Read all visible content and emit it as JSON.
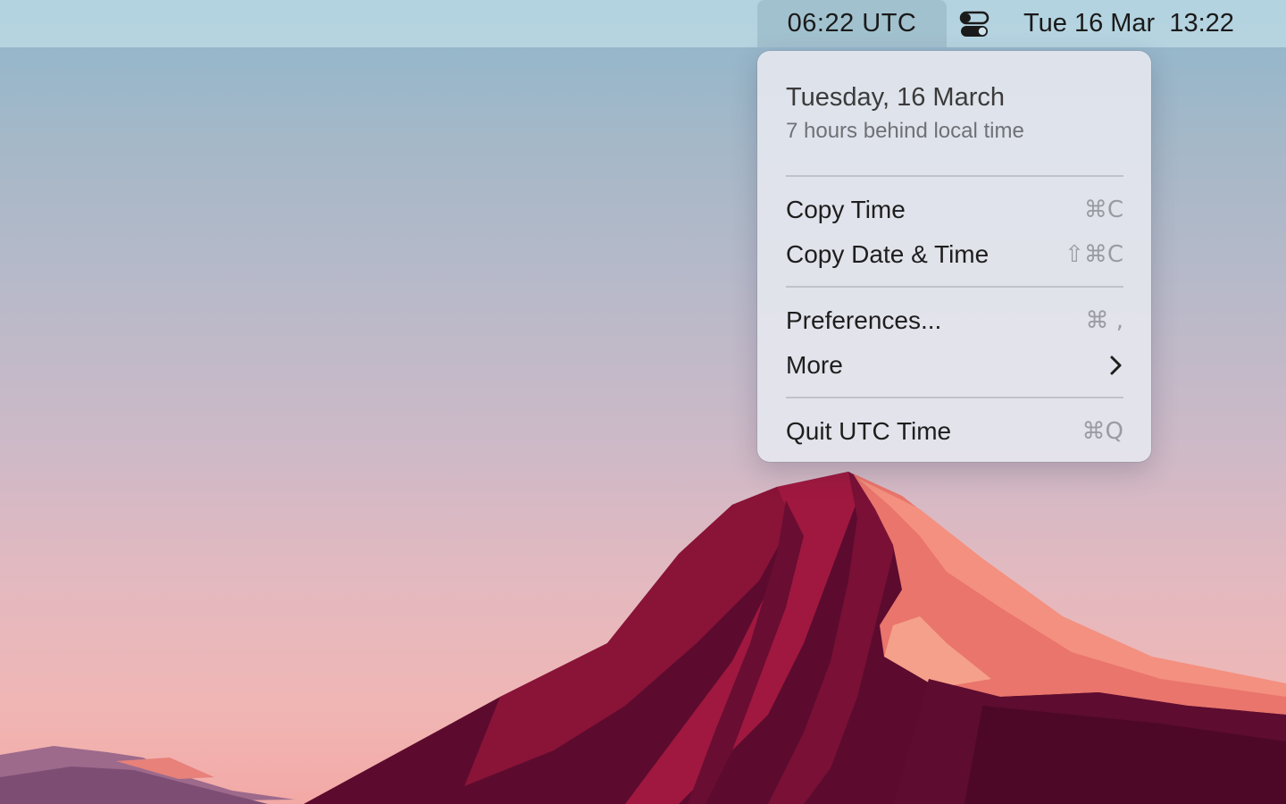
{
  "menubar": {
    "utc_time": "06:22 UTC",
    "control_center_icon": "toggle-switches-icon",
    "clock": "Tue 16 Mar  13:22"
  },
  "menu": {
    "date": "Tuesday, 16 March",
    "offset": "7 hours behind local time",
    "items": [
      {
        "label": "Copy Time",
        "shortcut": "⌘C"
      },
      {
        "label": "Copy Date & Time",
        "shortcut": "⇧⌘C"
      },
      {
        "label": "Preferences...",
        "shortcut": "⌘ ,"
      },
      {
        "label": "More",
        "icon": "chevron-right-icon"
      },
      {
        "label": "Quit UTC Time",
        "shortcut": "⌘Q"
      }
    ]
  },
  "colors": {
    "menubar": "#b7d6e2",
    "menu_background": "#e5e8ee",
    "mountain_dark": "#5c0b2e",
    "mountain_mid": "#a0183f",
    "mountain_light": "#f08070"
  }
}
